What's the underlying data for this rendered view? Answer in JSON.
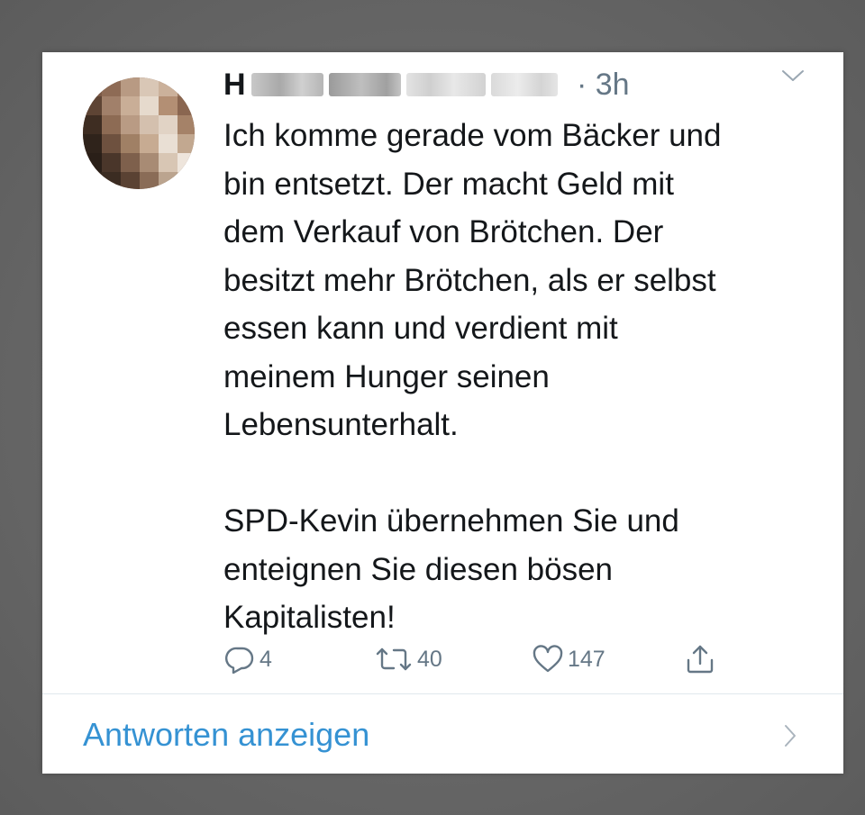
{
  "tweet": {
    "author_name_obscured": "H",
    "time": "· 3h",
    "text": "Ich komme gerade vom Bäcker und\nbin entsetzt. Der macht Geld mit\ndem Verkauf von Brötchen. Der\nbesitzt mehr Brötchen, als er selbst\nessen kann und verdient mit\nmeinem Hunger seinen\nLebensunterhalt.\n\nSPD-Kevin übernehmen Sie und\nenteignen Sie diesen bösen\nKapitalisten!",
    "actions": {
      "reply_count": "4",
      "retweet_count": "40",
      "like_count": "147"
    },
    "show_replies_label": "Antworten anzeigen"
  },
  "icons": {
    "menu": "chevron-down-icon",
    "reply": "reply-icon",
    "retweet": "retweet-icon",
    "like": "heart-icon",
    "share": "share-icon",
    "show_replies": "chevron-right-icon"
  },
  "colors": {
    "text": "#14171a",
    "secondary": "#657786",
    "link": "#3592d3",
    "divider": "#e1e8ed",
    "background": "#ffffff"
  }
}
